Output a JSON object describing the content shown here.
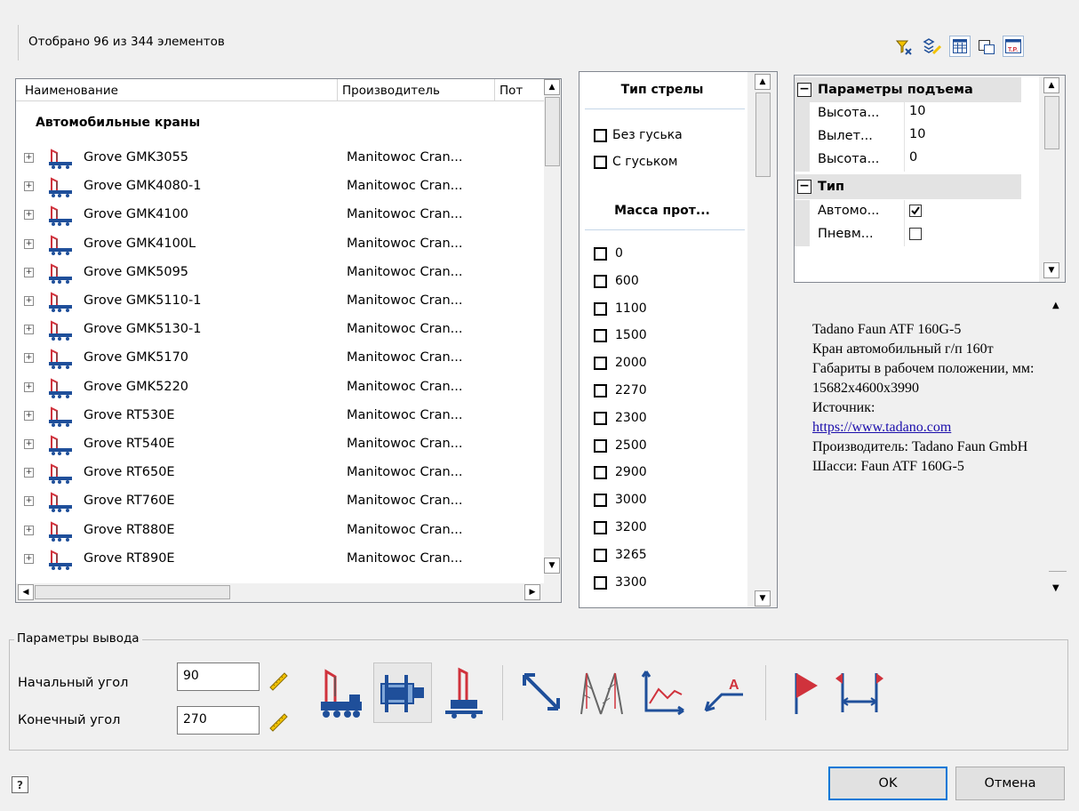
{
  "status": {
    "text": "Отобрано 96 из 344 элементов"
  },
  "toolbar": {
    "icons": [
      "filter-icon",
      "clear-filter-icon",
      "columns-icon",
      "preview-icon",
      "report-icon"
    ]
  },
  "list": {
    "columns": [
      "Наименование",
      "Производитель",
      "Пот"
    ],
    "group_title": "Автомобильные краны",
    "rows": [
      {
        "name": "Grove GMK3055",
        "manufacturer": "Manitowoc Cran..."
      },
      {
        "name": "Grove GMK4080-1",
        "manufacturer": "Manitowoc Cran..."
      },
      {
        "name": "Grove GMK4100",
        "manufacturer": "Manitowoc Cran..."
      },
      {
        "name": "Grove GMK4100L",
        "manufacturer": "Manitowoc Cran..."
      },
      {
        "name": "Grove GMK5095",
        "manufacturer": "Manitowoc Cran..."
      },
      {
        "name": "Grove GMK5110-1",
        "manufacturer": "Manitowoc Cran..."
      },
      {
        "name": "Grove GMK5130-1",
        "manufacturer": "Manitowoc Cran..."
      },
      {
        "name": "Grove GMK5170",
        "manufacturer": "Manitowoc Cran..."
      },
      {
        "name": "Grove GMK5220",
        "manufacturer": "Manitowoc Cran..."
      },
      {
        "name": "Grove RT530E",
        "manufacturer": "Manitowoc Cran..."
      },
      {
        "name": "Grove RT540E",
        "manufacturer": "Manitowoc Cran..."
      },
      {
        "name": "Grove RT650E",
        "manufacturer": "Manitowoc Cran..."
      },
      {
        "name": "Grove RT760E",
        "manufacturer": "Manitowoc Cran..."
      },
      {
        "name": "Grove RT880E",
        "manufacturer": "Manitowoc Cran..."
      },
      {
        "name": "Grove RT890E",
        "manufacturer": "Manitowoc Cran..."
      }
    ]
  },
  "filters": {
    "boom_heading": "Тип стрелы",
    "boom_options": [
      "Без гуська",
      "С гуськом"
    ],
    "mass_heading": "Масса прот...",
    "mass_options": [
      "0",
      "600",
      "1100",
      "1500",
      "2000",
      "2270",
      "2300",
      "2500",
      "2900",
      "3000",
      "3200",
      "3265",
      "3300"
    ]
  },
  "properties": {
    "cat1": "Параметры подъема",
    "cat1_toggle": "−",
    "rows1": [
      {
        "key": "Высота...",
        "value": "10"
      },
      {
        "key": "Вылет...",
        "value": "10"
      },
      {
        "key": "Высота...",
        "value": "0"
      }
    ],
    "cat2": "Тип",
    "cat2_toggle": "−",
    "rows2": [
      {
        "key": "Автомо...",
        "checked": true
      },
      {
        "key": "Пневм...",
        "checked": false
      }
    ]
  },
  "description": {
    "line1": "Tadano Faun ATF 160G-5",
    "line2": "Кран автомобильный г/п 160т",
    "line3": "Габариты в рабочем положении, мм: 15682x4600x3990",
    "line4": "Источник:",
    "link": "https://www.tadano.com",
    "line5": "Производитель: Tadano Faun GmbH",
    "line6": "Шасси: Faun ATF 160G-5"
  },
  "output": {
    "legend": "Параметры вывода",
    "start_label": "Начальный угол",
    "start_value": "90",
    "end_label": "Конечный угол",
    "end_value": "270"
  },
  "footer": {
    "ok": "OK",
    "cancel": "Отмена"
  },
  "colors": {
    "crane_red": "#d0323c",
    "tool_blue": "#1f4f9a",
    "link": "#1a0dab"
  }
}
